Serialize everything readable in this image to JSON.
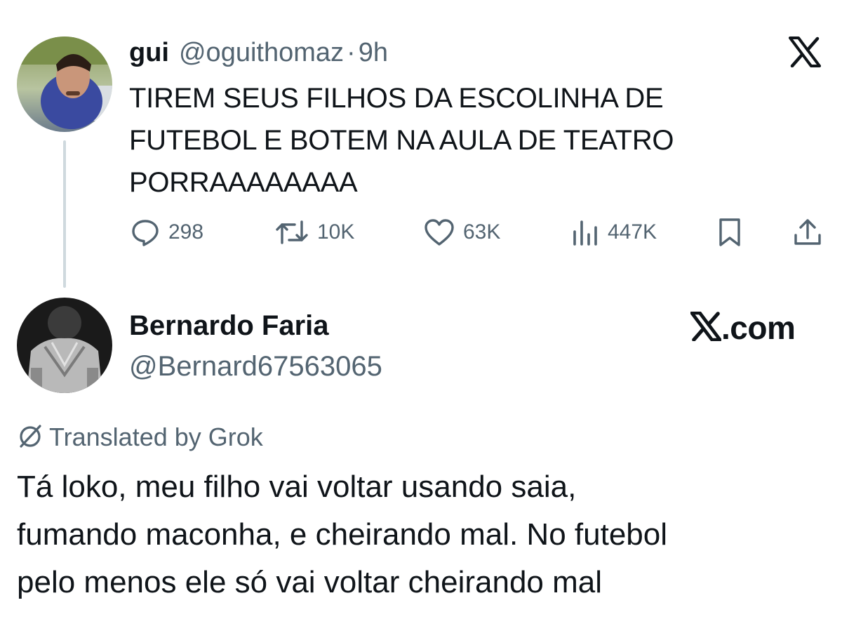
{
  "tweet": {
    "author_name": "gui",
    "author_handle": "@oguithomaz",
    "separator": "·",
    "time": "9h",
    "text": "TIREM SEUS FILHOS DA ESCOLINHA DE\nFUTEBOL E BOTEM NA AULA DE TEATRO\nPORRAAAAAAAA",
    "metrics": {
      "replies": "298",
      "reposts": "10K",
      "likes": "63K",
      "views": "447K"
    }
  },
  "reply": {
    "author_name": "Bernardo Faria",
    "author_handle": "@Bernard67563065",
    "translation_note": "Translated by Grok",
    "text": "Tá loko, meu filho vai voltar usando saia,\nfumando maconha, e cheirando mal. No futebol\npelo menos ele só vai voltar cheirando mal"
  },
  "watermark": {
    "logo_icon": "x-logo-icon",
    "text": ".com"
  },
  "icons": [
    "x-logo-icon",
    "reply-icon",
    "repost-icon",
    "like-icon",
    "views-icon",
    "bookmark-icon",
    "share-icon",
    "translate-icon"
  ],
  "colors": {
    "text": "#0f1419",
    "secondary": "#536471",
    "thread_line": "#cfd9de",
    "background": "#ffffff"
  }
}
